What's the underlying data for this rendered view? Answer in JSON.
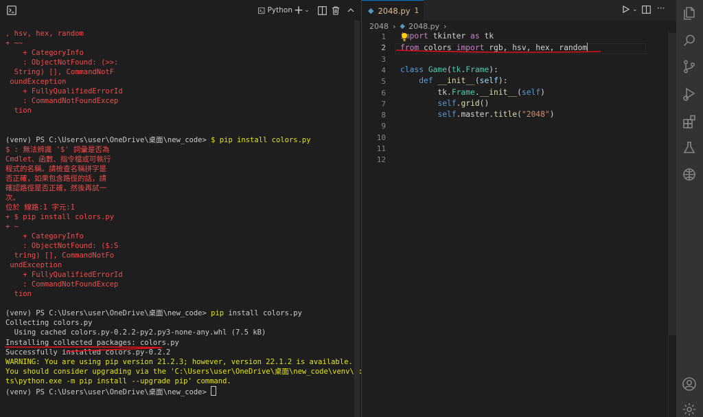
{
  "terminal": {
    "shell_name": "Python",
    "lines": [
      {
        "text": ", hsv, hex, random",
        "color": "red"
      },
      {
        "text": "+ ~~",
        "color": "red"
      },
      {
        "text": "    + CategoryInfo",
        "color": "red"
      },
      {
        "text": "    : ObjectNotFound: (>>:",
        "color": "red"
      },
      {
        "text": "  String) [], CommandNotF",
        "color": "red"
      },
      {
        "text": " oundException",
        "color": "red"
      },
      {
        "text": "    + FullyQualifiedErrorId",
        "color": "red"
      },
      {
        "text": "    : CommandNotFoundExcep",
        "color": "red"
      },
      {
        "text": "  tion",
        "color": "red"
      },
      {
        "text": "",
        "color": "red"
      },
      {
        "text": "",
        "color": "red"
      },
      {
        "segments": [
          {
            "text": "(venv) PS C:\\Users\\user\\OneDrive\\桌面\\new_code> ",
            "color": "wht"
          },
          {
            "text": "$ pip install colors.py",
            "color": "yel"
          }
        ]
      },
      {
        "text": "$ : 無法辨識 '$' 詞彙是否為",
        "color": "red"
      },
      {
        "text": "Cmdlet、函數、指令檔或可執行",
        "color": "red"
      },
      {
        "text": "程式的名稱。請檢查名稱拼字是",
        "color": "red"
      },
      {
        "text": "否正確，如果包含路徑的話，請",
        "color": "red"
      },
      {
        "text": "確認路徑是否正確，然後再試一",
        "color": "red"
      },
      {
        "text": "次。",
        "color": "red"
      },
      {
        "text": "位於 線路:1 字元:1",
        "color": "red"
      },
      {
        "text": "+ $ pip install colors.py",
        "color": "red"
      },
      {
        "text": "+ ~",
        "color": "red"
      },
      {
        "text": "    + CategoryInfo",
        "color": "red"
      },
      {
        "text": "    : ObjectNotFound: ($:S",
        "color": "red"
      },
      {
        "text": "  tring) [], CommandNotFo",
        "color": "red"
      },
      {
        "text": " undException",
        "color": "red"
      },
      {
        "text": "    + FullyQualifiedErrorId",
        "color": "red"
      },
      {
        "text": "    : CommandNotFoundExcep",
        "color": "red"
      },
      {
        "text": "  tion",
        "color": "red"
      },
      {
        "text": "",
        "color": "red"
      },
      {
        "segments": [
          {
            "text": "(venv) PS C:\\Users\\user\\OneDrive\\桌面\\new_code> ",
            "color": "wht"
          },
          {
            "text": "pip",
            "color": "yel"
          },
          {
            "text": " install colors.py",
            "color": "wht"
          }
        ]
      },
      {
        "text": "Collecting colors.py",
        "color": "wht"
      },
      {
        "text": "  Using cached colors.py-0.2.2-py2.py3-none-any.whl (7.5 kB)",
        "color": "wht"
      },
      {
        "text": "Installing collected packages: colors.py",
        "color": "wht"
      },
      {
        "text": "Successfully installed colors.py-0.2.2",
        "color": "wht"
      },
      {
        "text": "WARNING: You are using pip version 21.2.3; however, version 22.1.2 is available.",
        "color": "yel"
      },
      {
        "text": "You should consider upgrading via the 'C:\\Users\\user\\OneDrive\\桌面\\new_code\\venv\\Scrip",
        "color": "yel"
      },
      {
        "text": "ts\\python.exe -m pip install --upgrade pip' command.",
        "color": "yel"
      },
      {
        "segments": [
          {
            "text": "(venv) PS C:\\Users\\user\\OneDrive\\桌面\\new_code> ",
            "color": "wht"
          }
        ],
        "cursor": true
      }
    ]
  },
  "editor": {
    "tab": {
      "filename": "2048.py",
      "modified_count": "1"
    },
    "breadcrumb": {
      "folder": "2048",
      "file": "2048.py"
    },
    "line_numbers": [
      "1",
      "2",
      "3",
      "4",
      "5",
      "6",
      "7",
      "8",
      "9",
      "10",
      "11",
      "12"
    ],
    "code": [
      [
        {
          "t": "im",
          "c": "kw2"
        },
        {
          "t": "port",
          "c": "kw2"
        },
        {
          "t": " tkinter ",
          "c": "pl"
        },
        {
          "t": "as",
          "c": "kw2"
        },
        {
          "t": " tk",
          "c": "pl"
        }
      ],
      [
        {
          "t": "from",
          "c": "kw2"
        },
        {
          "t": " colors ",
          "c": "pl"
        },
        {
          "t": "import",
          "c": "kw2"
        },
        {
          "t": " rgb, hsv, hex, random",
          "c": "pl"
        }
      ],
      [],
      [
        {
          "t": "class",
          "c": "kw"
        },
        {
          "t": " ",
          "c": "pl"
        },
        {
          "t": "Game",
          "c": "cls"
        },
        {
          "t": "(",
          "c": "pl"
        },
        {
          "t": "tk",
          "c": "cls"
        },
        {
          "t": ".",
          "c": "pl"
        },
        {
          "t": "Frame",
          "c": "cls"
        },
        {
          "t": "):",
          "c": "pl"
        }
      ],
      [
        {
          "t": "    ",
          "c": "pl"
        },
        {
          "t": "def",
          "c": "kw"
        },
        {
          "t": " ",
          "c": "pl"
        },
        {
          "t": "__init__",
          "c": "fn"
        },
        {
          "t": "(",
          "c": "pl"
        },
        {
          "t": "self",
          "c": "prm"
        },
        {
          "t": "):",
          "c": "pl"
        }
      ],
      [
        {
          "t": "        tk.",
          "c": "pl"
        },
        {
          "t": "Frame",
          "c": "cls"
        },
        {
          "t": ".",
          "c": "pl"
        },
        {
          "t": "__init__",
          "c": "fn"
        },
        {
          "t": "(",
          "c": "pl"
        },
        {
          "t": "self",
          "c": "kw"
        },
        {
          "t": ")",
          "c": "pl"
        }
      ],
      [
        {
          "t": "        ",
          "c": "pl"
        },
        {
          "t": "self",
          "c": "kw"
        },
        {
          "t": ".",
          "c": "pl"
        },
        {
          "t": "grid",
          "c": "fn"
        },
        {
          "t": "()",
          "c": "pl"
        }
      ],
      [
        {
          "t": "        ",
          "c": "pl"
        },
        {
          "t": "self",
          "c": "kw"
        },
        {
          "t": ".master.",
          "c": "pl"
        },
        {
          "t": "title",
          "c": "fn"
        },
        {
          "t": "(",
          "c": "pl"
        },
        {
          "t": "\"2048\"",
          "c": "str"
        },
        {
          "t": ")",
          "c": "pl"
        }
      ],
      [],
      [],
      [],
      []
    ]
  },
  "icons": {
    "terminal_toggle": "terminal-icon",
    "new_terminal": "plus-icon",
    "split": "split-icon",
    "trash": "trash-icon",
    "run": "run-icon",
    "more": "ellipsis-icon",
    "activity": [
      "explorer-icon",
      "search-icon",
      "source-control-icon",
      "run-debug-icon",
      "extensions-icon",
      "testing-icon",
      "remote-icon",
      "account-icon",
      "settings-icon"
    ]
  },
  "colors": {
    "terminal_error": "#f14c4c",
    "terminal_warning": "#e5e510",
    "annotation": "#e0101a",
    "background": "#1e1e1e"
  }
}
